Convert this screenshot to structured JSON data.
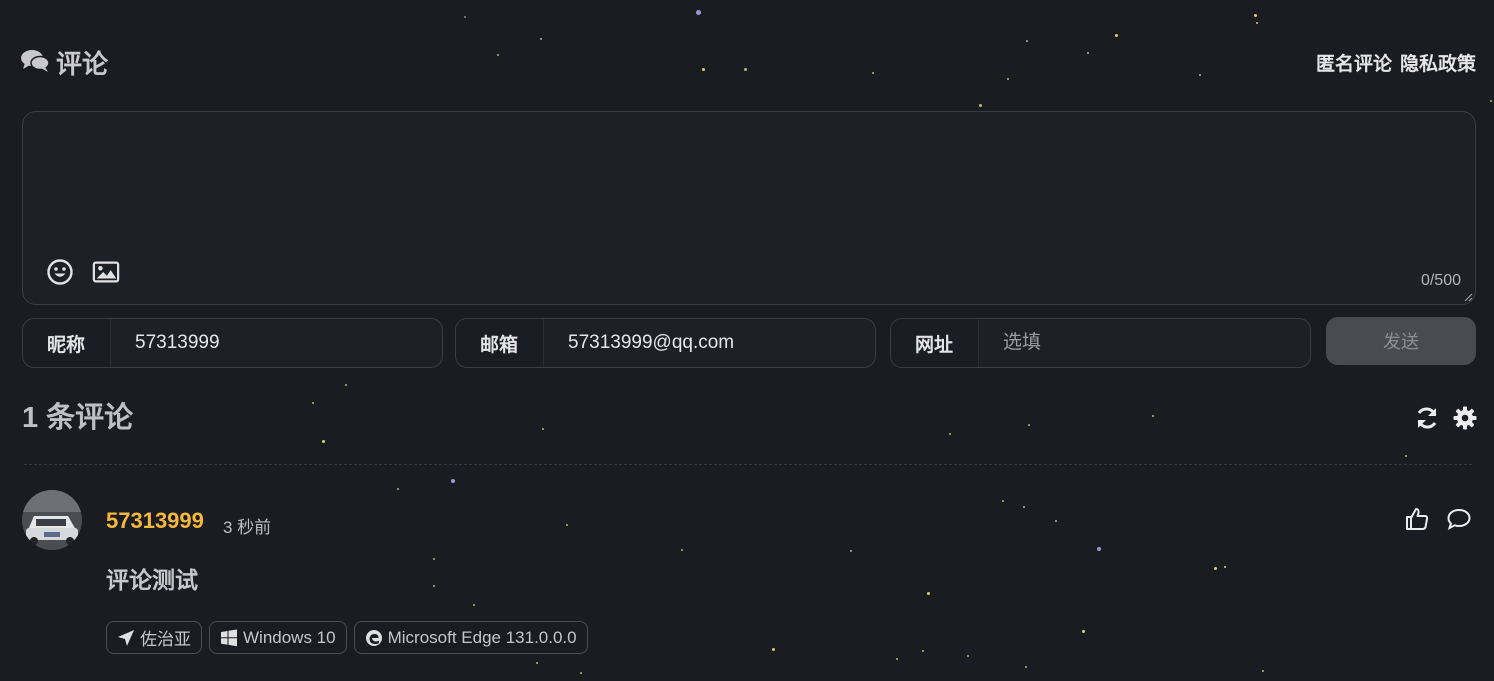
{
  "header": {
    "title": "评论",
    "links": [
      "匿名评论",
      "隐私政策"
    ]
  },
  "editor": {
    "placeholder": "",
    "counter": "0/500",
    "tools": [
      "emoji-icon",
      "image-icon"
    ]
  },
  "form": {
    "nick": {
      "label": "昵称",
      "value": "57313999",
      "placeholder": ""
    },
    "mail": {
      "label": "邮箱",
      "value": "57313999@qq.com",
      "placeholder": ""
    },
    "link": {
      "label": "网址",
      "value": "",
      "placeholder": "选填"
    },
    "submit_label": "发送"
  },
  "comments_header": {
    "count_label": "1 条评论",
    "actions": [
      "refresh-icon",
      "settings-icon"
    ]
  },
  "comments": [
    {
      "nick": "57313999",
      "time": "3 秒前",
      "content": "评论测试",
      "tags": {
        "location": "佐治亚",
        "os": "Windows 10",
        "browser": "Microsoft Edge 131.0.0.0"
      }
    }
  ],
  "colors": {
    "background": "#1b1c21",
    "nick": "#f5b83a",
    "border": "#3b3d45",
    "button": "#4a4b50"
  }
}
